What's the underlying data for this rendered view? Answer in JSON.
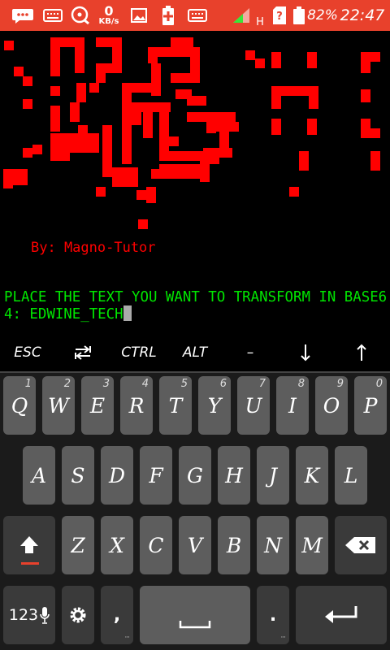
{
  "statusbar": {
    "net_speed_value": "0",
    "net_speed_unit": "KB/s",
    "network_type": "H",
    "battery_percent": "82%",
    "time": "22:47",
    "accent_color": "#e8412c"
  },
  "terminal": {
    "byline": "By: Magno-Tutor",
    "prompt_text": "PLACE THE TEXT YOU WANT TO TRANSFORM IN BASE64: ",
    "input_value": "EDWINE_TECH",
    "prompt_color": "#00e600",
    "art_color": "#ff0000"
  },
  "extra_keys": [
    {
      "name": "esc-key",
      "label": "ESC"
    },
    {
      "name": "tab-key",
      "icon": "tab-arrows-icon"
    },
    {
      "name": "ctrl-key",
      "label": "CTRL"
    },
    {
      "name": "alt-key",
      "label": "ALT"
    },
    {
      "name": "dash-key",
      "label": "–"
    },
    {
      "name": "arrow-down-key",
      "icon": "arrow-down-icon"
    },
    {
      "name": "arrow-up-key",
      "icon": "arrow-up-icon"
    }
  ],
  "keyboard": {
    "row1": [
      {
        "label": "Q",
        "hint": "1"
      },
      {
        "label": "W",
        "hint": "2"
      },
      {
        "label": "E",
        "hint": "3"
      },
      {
        "label": "R",
        "hint": "4"
      },
      {
        "label": "T",
        "hint": "5"
      },
      {
        "label": "Y",
        "hint": "6"
      },
      {
        "label": "U",
        "hint": "7"
      },
      {
        "label": "I",
        "hint": "8"
      },
      {
        "label": "O",
        "hint": "9"
      },
      {
        "label": "P",
        "hint": "0"
      }
    ],
    "row2": [
      "A",
      "S",
      "D",
      "F",
      "G",
      "H",
      "J",
      "K",
      "L"
    ],
    "row3": [
      "Z",
      "X",
      "C",
      "V",
      "B",
      "N",
      "M"
    ],
    "symbols_label": "123",
    "comma_label": ",",
    "period_label": "."
  }
}
